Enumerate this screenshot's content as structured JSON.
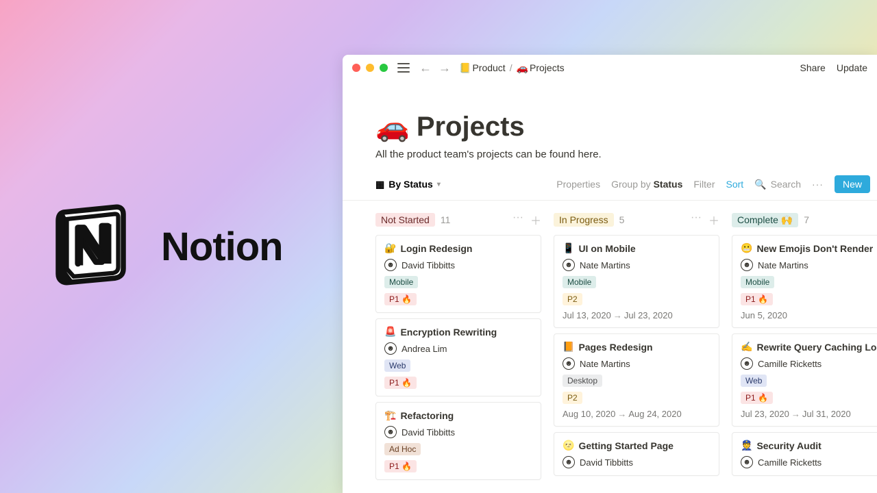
{
  "brand": {
    "name": "Notion"
  },
  "window": {
    "breadcrumb": [
      {
        "icon": "📒",
        "label": "Product"
      },
      {
        "icon": "🚗",
        "label": "Projects"
      }
    ],
    "breadcrumb_sep": "/",
    "share": "Share",
    "updates": "Update"
  },
  "page": {
    "icon": "🚗",
    "title": "Projects",
    "description": "All the product team's projects can be found here."
  },
  "toolbar": {
    "view_label": "By Status",
    "properties": "Properties",
    "groupby_label": "Group by",
    "groupby_value": "Status",
    "filter": "Filter",
    "sort": "Sort",
    "search": "Search",
    "new": "New"
  },
  "columns": [
    {
      "name": "Not Started",
      "count": "11",
      "badge_class": "badge-notstarted",
      "cards": [
        {
          "icon": "🔐",
          "title": "Login Redesign",
          "assignee": "David Tibbitts",
          "tags": [
            {
              "text": "Mobile",
              "cls": "tag-mobile"
            }
          ],
          "priority": {
            "text": "P1 🔥",
            "cls": "tag-p1"
          }
        },
        {
          "icon": "🚨",
          "title": "Encryption Rewriting",
          "assignee": "Andrea Lim",
          "tags": [
            {
              "text": "Web",
              "cls": "tag-web"
            }
          ],
          "priority": {
            "text": "P1 🔥",
            "cls": "tag-p1"
          }
        },
        {
          "icon": "🏗️",
          "title": "Refactoring",
          "assignee": "David Tibbitts",
          "tags": [
            {
              "text": "Ad Hoc",
              "cls": "tag-adhoc"
            }
          ],
          "priority": {
            "text": "P1 🔥",
            "cls": "tag-p1"
          }
        }
      ]
    },
    {
      "name": "In Progress",
      "count": "5",
      "badge_class": "badge-inprogress",
      "cards": [
        {
          "icon": "📱",
          "title": "UI on Mobile",
          "assignee": "Nate Martins",
          "tags": [
            {
              "text": "Mobile",
              "cls": "tag-mobile"
            }
          ],
          "priority": {
            "text": "P2",
            "cls": "tag-p2"
          },
          "dates": {
            "from": "Jul 13, 2020",
            "to": "Jul 23, 2020"
          }
        },
        {
          "icon": "📙",
          "title": "Pages Redesign",
          "assignee": "Nate Martins",
          "tags": [
            {
              "text": "Desktop",
              "cls": "tag-desktop"
            }
          ],
          "priority": {
            "text": "P2",
            "cls": "tag-p2"
          },
          "dates": {
            "from": "Aug 10, 2020",
            "to": "Aug 24, 2020"
          }
        },
        {
          "icon": "🌝",
          "title": "Getting Started Page",
          "assignee": "David Tibbitts"
        }
      ]
    },
    {
      "name": "Complete 🙌",
      "count": "7",
      "badge_class": "badge-complete",
      "cards": [
        {
          "icon": "😬",
          "title": "New Emojis Don't Render",
          "assignee": "Nate Martins",
          "tags": [
            {
              "text": "Mobile",
              "cls": "tag-mobile"
            }
          ],
          "priority": {
            "text": "P1 🔥",
            "cls": "tag-p1"
          },
          "dates": {
            "single": "Jun 5, 2020"
          }
        },
        {
          "icon": "✍️",
          "title": "Rewrite Query Caching Logic",
          "assignee": "Camille Ricketts",
          "tags": [
            {
              "text": "Web",
              "cls": "tag-web"
            }
          ],
          "priority": {
            "text": "P1 🔥",
            "cls": "tag-p1"
          },
          "dates": {
            "from": "Jul 23, 2020",
            "to": "Jul 31, 2020"
          }
        },
        {
          "icon": "👮",
          "title": "Security Audit",
          "assignee": "Camille Ricketts"
        }
      ]
    }
  ]
}
